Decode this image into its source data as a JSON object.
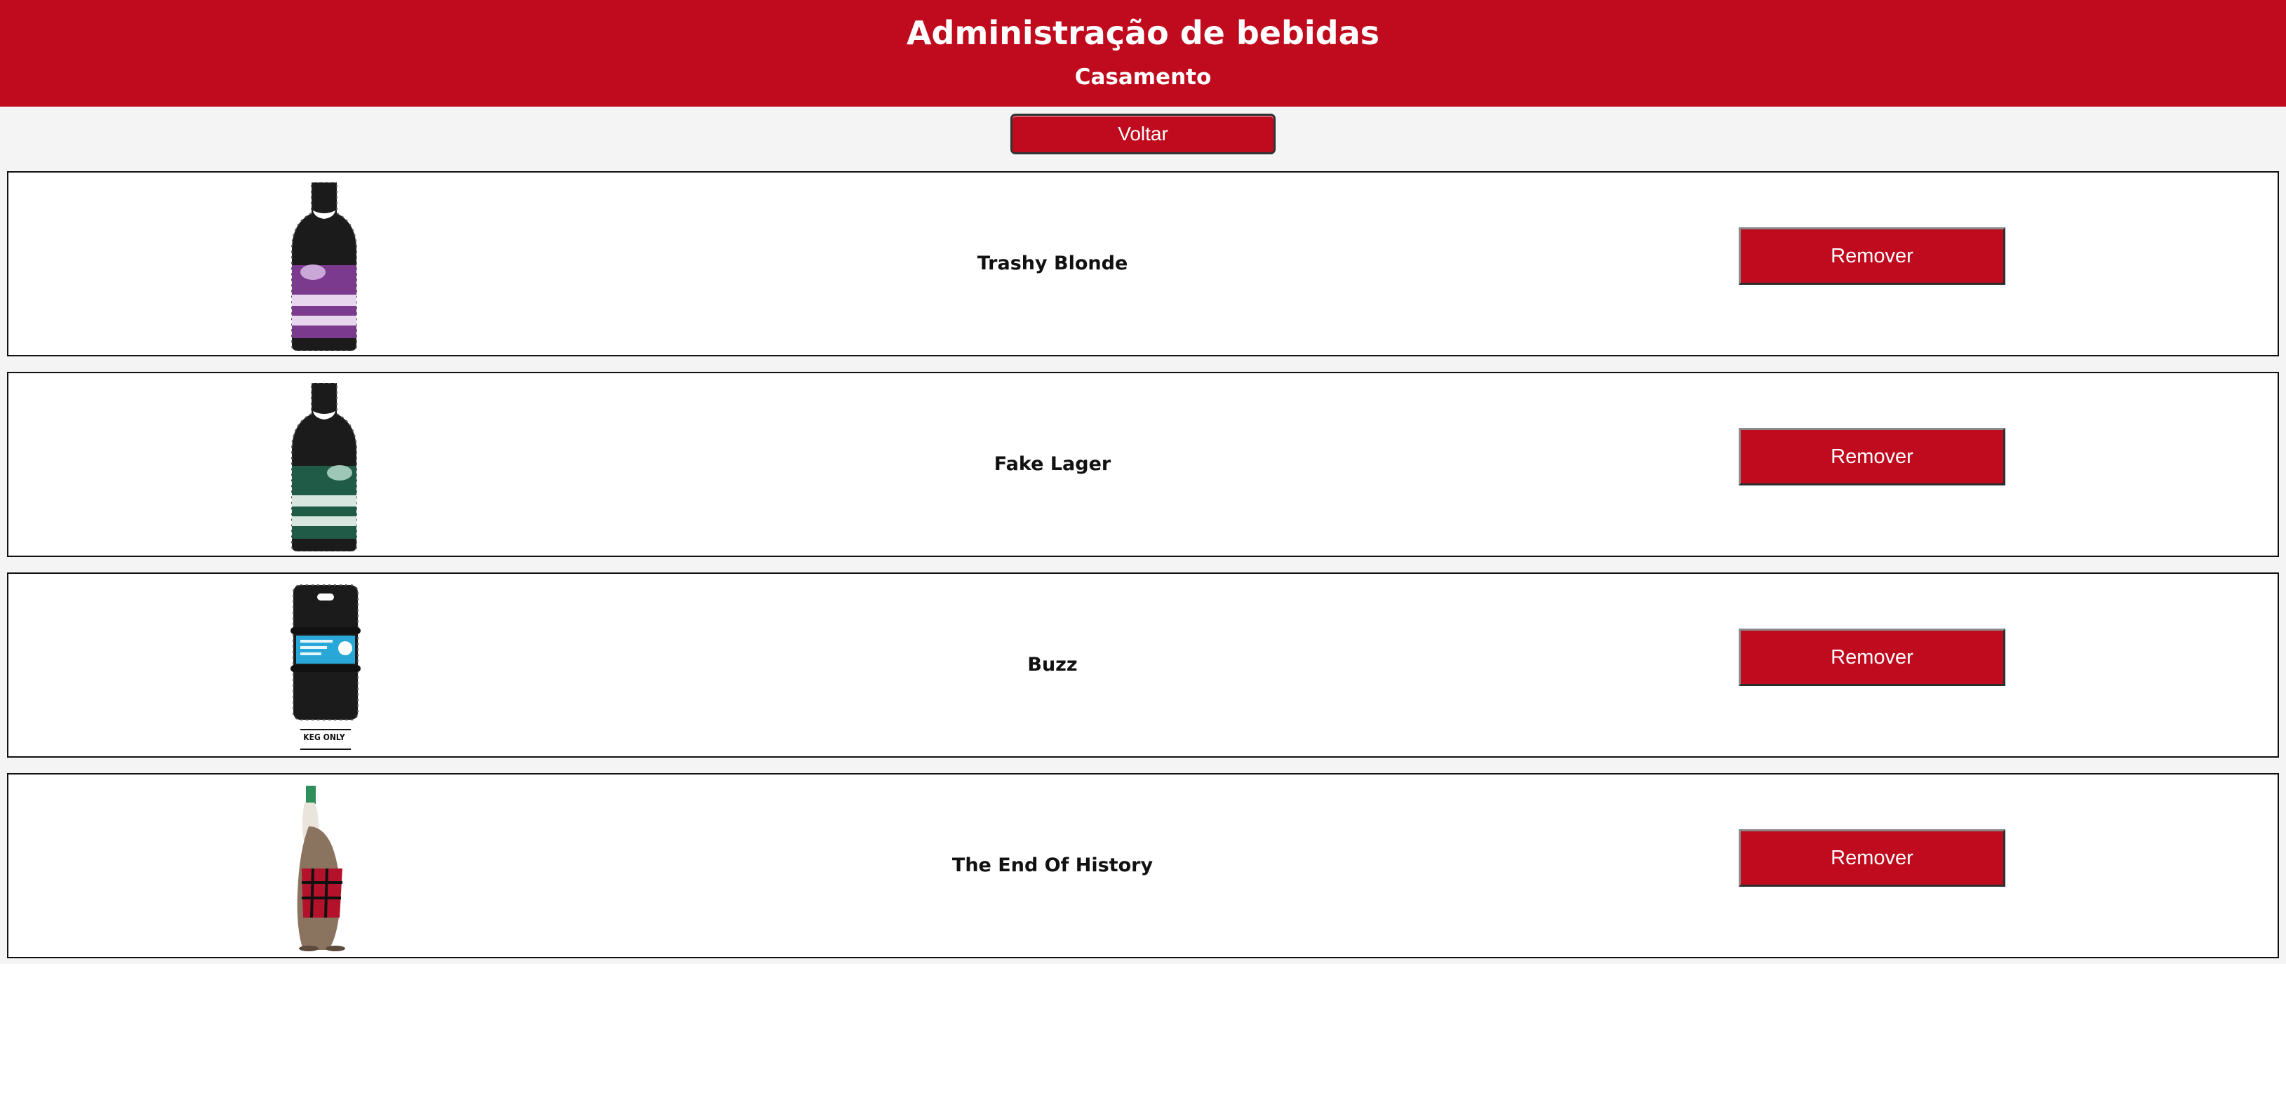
{
  "header": {
    "title": "Administração de bebidas",
    "subtitle": "Casamento"
  },
  "actions": {
    "back_label": "Voltar"
  },
  "drinks": [
    {
      "name": "Trashy Blonde",
      "image": "trashy-blonde-bottle",
      "label_color": "#7b3a8e",
      "remove_label": "Remover"
    },
    {
      "name": "Fake Lager",
      "image": "fake-lager-bottle",
      "label_color": "#1f5b47",
      "remove_label": "Remover"
    },
    {
      "name": "Buzz",
      "image": "buzz-keg",
      "label_color": "#28a7d8",
      "keg_text": "KEG ONLY",
      "remove_label": "Remover"
    },
    {
      "name": "The End Of History",
      "image": "end-of-history-bottle",
      "label_color": "#b3122a",
      "remove_label": "Remover"
    }
  ],
  "colors": {
    "brand": "#c00b1e",
    "background": "#f4f4f4"
  }
}
